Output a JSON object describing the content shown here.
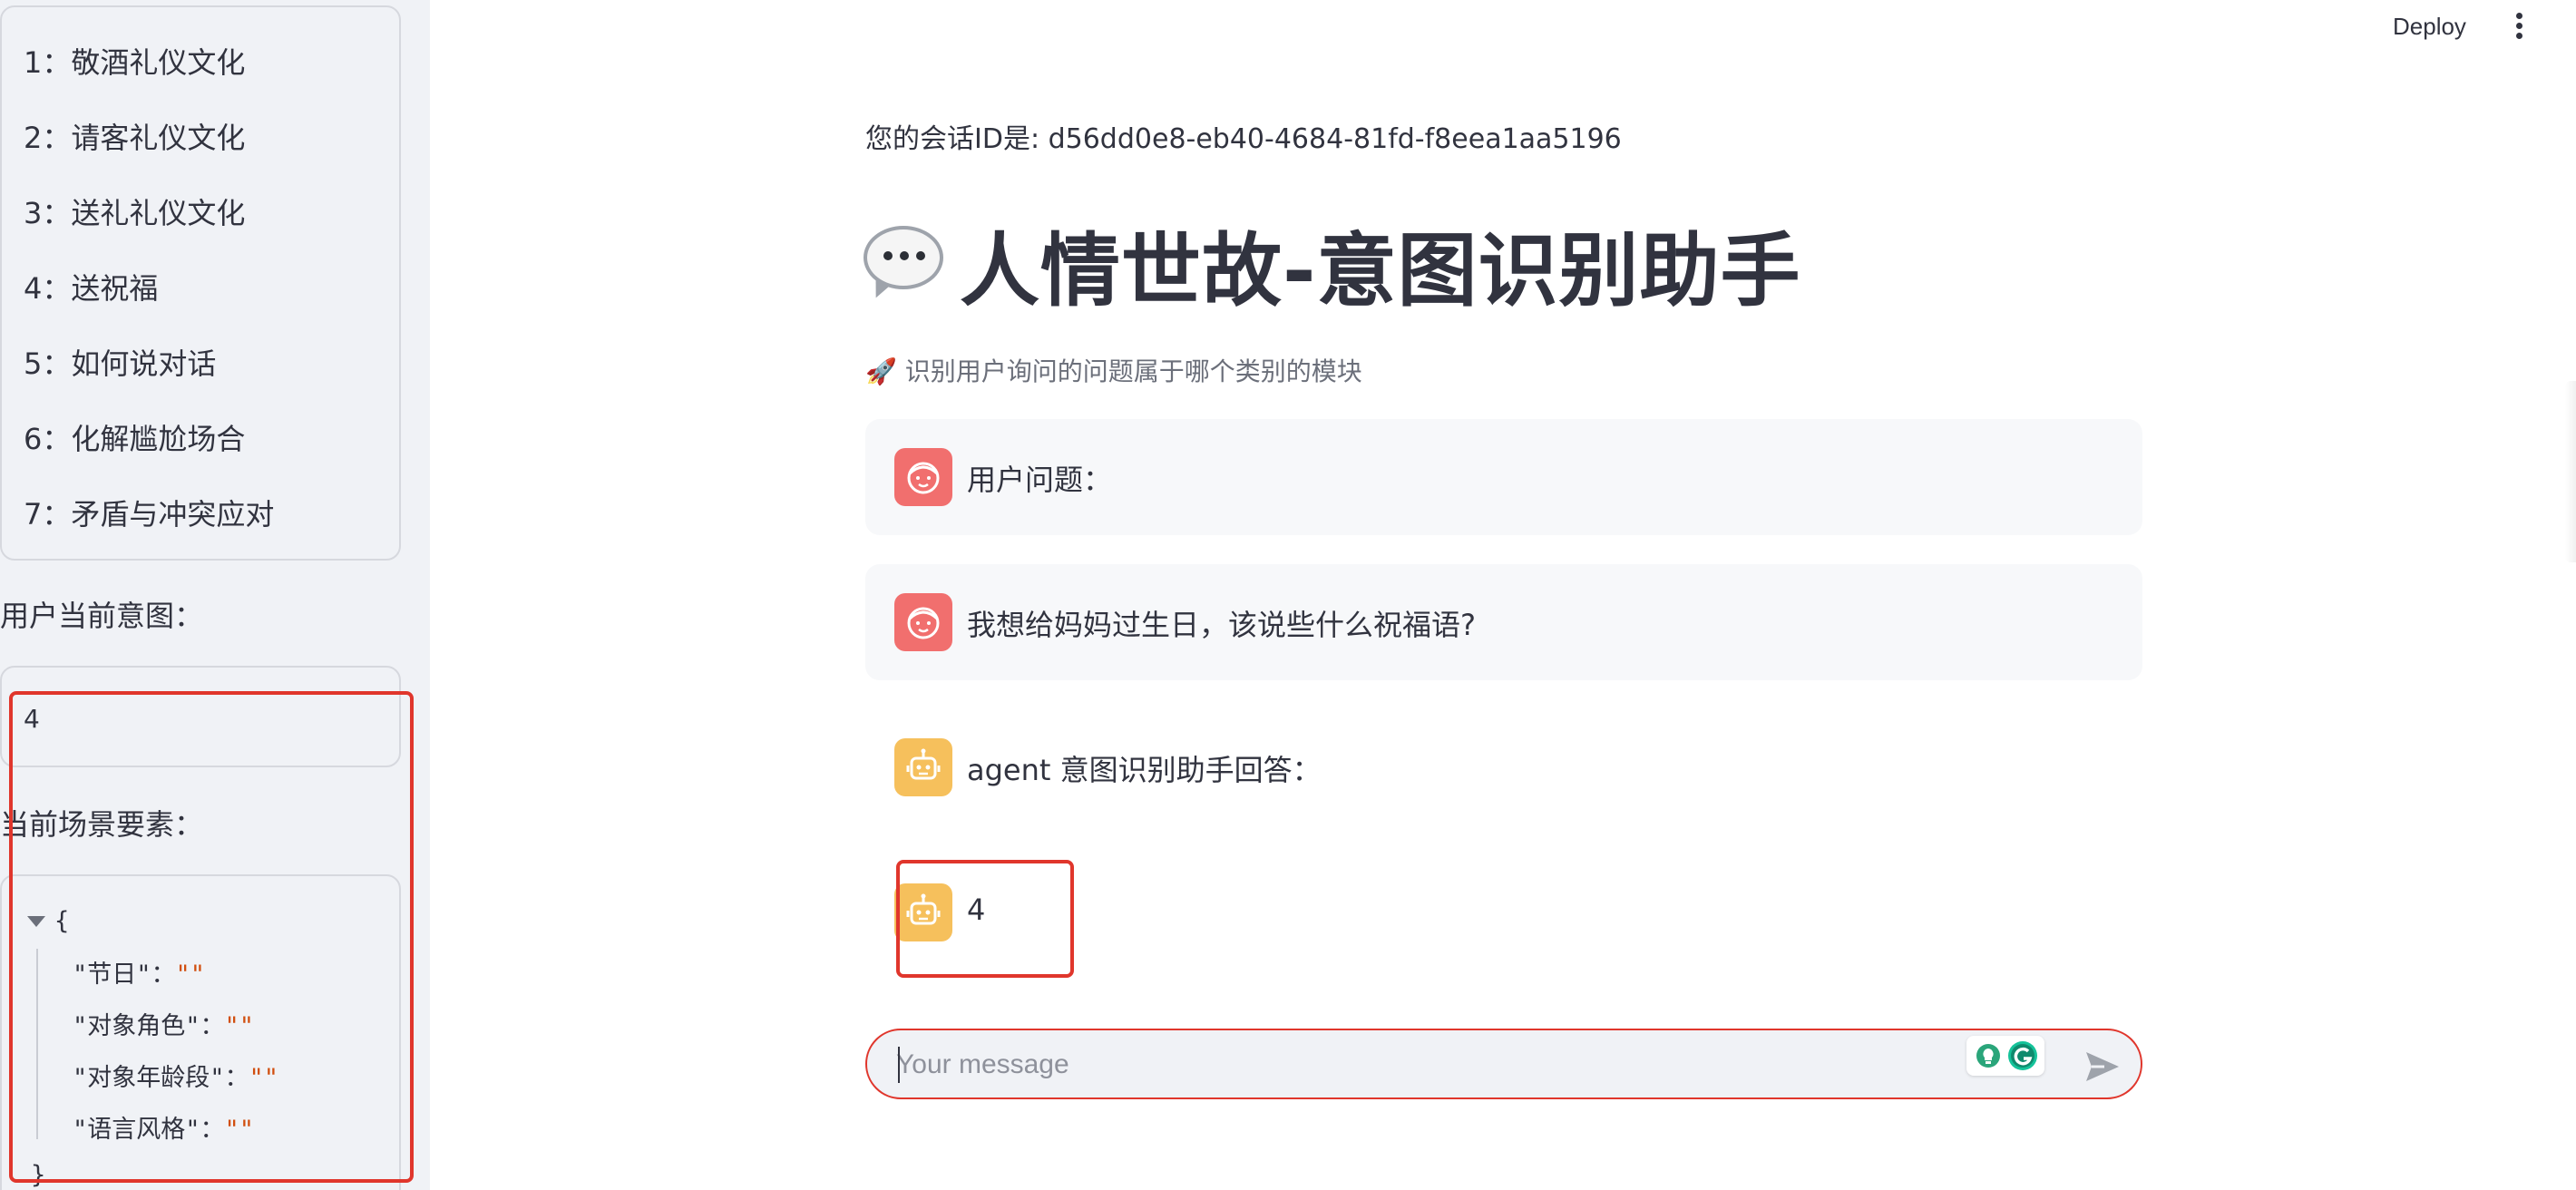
{
  "header": {
    "deploy_label": "Deploy",
    "menu_icon": "more-vertical-icon"
  },
  "sidebar": {
    "categories": [
      "1：敬酒礼仪文化",
      "2：请客礼仪文化",
      "3：送礼礼仪文化",
      "4：送祝福",
      "5：如何说对话",
      "6：化解尴尬场合",
      "7：矛盾与冲突应对"
    ],
    "intent_label": "用户当前意图：",
    "intent_value": "4",
    "scene_label": "当前场景要素：",
    "scene_json": {
      "open_brace": "{",
      "close_brace": "}",
      "colon": "：",
      "fields": [
        {
          "key": "\"节日\"",
          "value": "\"\""
        },
        {
          "key": "\"对象角色\"",
          "value": "\"\""
        },
        {
          "key": "\"对象年龄段\"",
          "value": "\"\""
        },
        {
          "key": "\"语言风格\"",
          "value": "\"\""
        }
      ]
    }
  },
  "main": {
    "session_line": "您的会话ID是: d56dd0e8-eb40-4684-81fd-f8eea1aa5196",
    "title_icon": "speech-bubble-icon",
    "title": "人情世故-意图识别助手",
    "subtitle": "🚀 识别用户询问的问题属于哪个类别的模块",
    "messages": [
      {
        "role": "user",
        "avatar": "user-face-icon",
        "text": "用户问题："
      },
      {
        "role": "user",
        "avatar": "user-face-icon",
        "text": "我想给妈妈过生日，该说些什么祝福语?"
      },
      {
        "role": "assistant",
        "avatar": "robot-icon",
        "text": "agent 意图识别助手回答："
      },
      {
        "role": "assistant",
        "avatar": "robot-icon",
        "text": "4"
      }
    ],
    "input": {
      "placeholder": "Your message",
      "send_icon": "send-icon"
    }
  },
  "colors": {
    "sidebar_bg": "#f0f2f6",
    "user_avatar": "#f16f6e",
    "bot_avatar": "#f6c05c",
    "annotation_red": "#e0362c",
    "json_string": "#d14e0e"
  }
}
